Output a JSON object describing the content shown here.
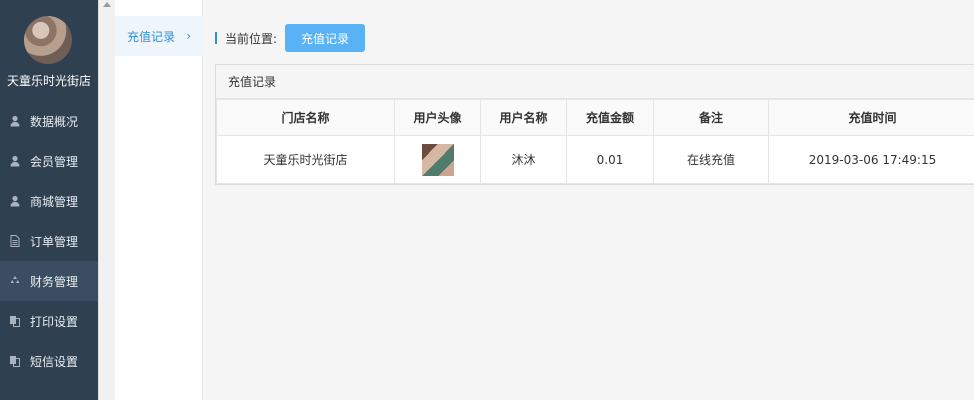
{
  "sidebar": {
    "store_name": "天童乐时光街店",
    "items": [
      {
        "label": "数据概况",
        "icon": "user-icon"
      },
      {
        "label": "会员管理",
        "icon": "user-icon"
      },
      {
        "label": "商城管理",
        "icon": "user-icon"
      },
      {
        "label": "订单管理",
        "icon": "file-icon"
      },
      {
        "label": "财务管理",
        "icon": "recycle-icon",
        "active": true
      },
      {
        "label": "打印设置",
        "icon": "copy-icon"
      },
      {
        "label": "短信设置",
        "icon": "copy-icon"
      }
    ]
  },
  "subnav": {
    "item_label": "充值记录",
    "chevron": "›"
  },
  "breadcrumb": {
    "label": "当前位置:",
    "button": "充值记录"
  },
  "panel": {
    "title": "充值记录",
    "columns": [
      "门店名称",
      "用户头像",
      "用户名称",
      "充值金额",
      "备注",
      "充值时间"
    ],
    "rows": [
      {
        "store": "天童乐时光街店",
        "username": "沐沐",
        "amount": "0.01",
        "note": "在线充值",
        "time": "2019-03-06 17:49:15"
      }
    ]
  }
}
